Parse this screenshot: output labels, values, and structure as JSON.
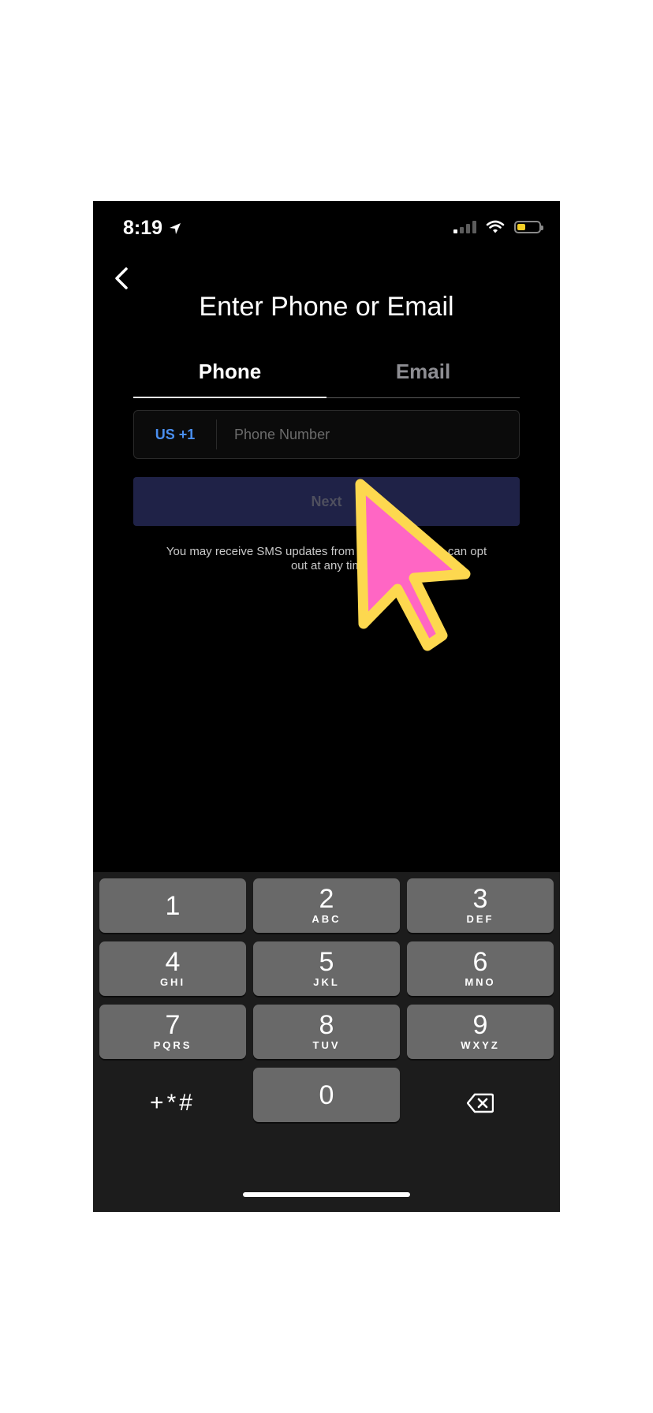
{
  "status_bar": {
    "time": "8:19"
  },
  "screen": {
    "title": "Enter Phone or Email",
    "tabs": [
      {
        "label": "Phone",
        "active": true
      },
      {
        "label": "Email",
        "active": false
      }
    ],
    "phone_input": {
      "country_code": "US +1",
      "placeholder": "Phone Number",
      "value": ""
    },
    "next_label": "Next",
    "sms_note": "You may receive SMS updates from [obscured] can opt out at any tim[obscured]",
    "sms_note_visible_line1": "You may receive SMS updates from",
    "sms_note_visible_line1b": "can opt",
    "sms_note_visible_line2": "out at any tim"
  },
  "keyboard": {
    "keys": [
      {
        "digit": "1",
        "letters": ""
      },
      {
        "digit": "2",
        "letters": "ABC"
      },
      {
        "digit": "3",
        "letters": "DEF"
      },
      {
        "digit": "4",
        "letters": "GHI"
      },
      {
        "digit": "5",
        "letters": "JKL"
      },
      {
        "digit": "6",
        "letters": "MNO"
      },
      {
        "digit": "7",
        "letters": "PQRS"
      },
      {
        "digit": "8",
        "letters": "TUV"
      },
      {
        "digit": "9",
        "letters": "WXYZ"
      },
      {
        "digit": "0",
        "letters": ""
      }
    ],
    "symbols_label": "+*#",
    "delete_icon": "backspace-icon"
  },
  "colors": {
    "accent": "#4a8ff0",
    "next_button_bg": "#1f2247",
    "cursor_fill": "#ff66c4",
    "cursor_stroke": "#fdd84f",
    "battery_fill": "#f5cf25"
  }
}
